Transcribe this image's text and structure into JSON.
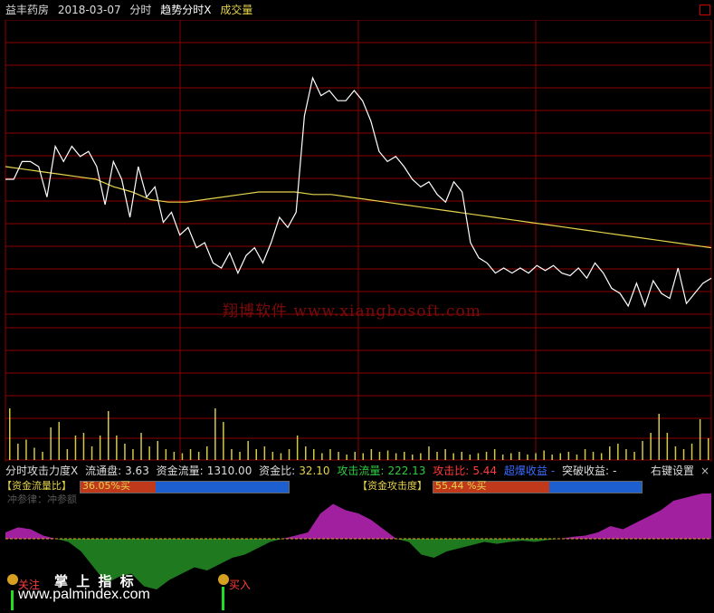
{
  "header": {
    "stock_name": "益丰药房",
    "date": "2018-03-07",
    "view": "分时",
    "indicator": "趋势分时X",
    "volume_label": "成交量"
  },
  "watermark": {
    "text": "翔博软件 www.xiangbosoft.com",
    "color": "#7a0b0b"
  },
  "indicator_bar": {
    "title": "分时攻击力度X",
    "float_label": "流通盘:",
    "float_value": "3.63",
    "fund_flow_label": "资金流量:",
    "fund_flow_value": "1310.00",
    "fund_ratio_label": "资金比:",
    "fund_ratio_value": "32.10",
    "attack_flow_label": "攻击流量:",
    "attack_flow_value": "222.13",
    "attack_ratio_label": "攻击比:",
    "attack_ratio_value": "5.44",
    "ultra_label": "超爆收益",
    "dash1": "-",
    "breakout_label": "突破收益:",
    "breakout_value": "-",
    "settings": "右键设置",
    "close": "×"
  },
  "fund_flow_ratio": {
    "label_open": "【资金流量比】",
    "value": "36.05%买",
    "fraction": 0.3605
  },
  "fund_attack": {
    "label_open": "【资金攻击度】",
    "value": "55.44 %买",
    "fraction": 0.5544
  },
  "sub_label": "冲参律：冲参额",
  "overlay": {
    "tag1": "关注",
    "slogan": "掌 上 指 标",
    "tag2": "买入",
    "url": "www.palmindex.com"
  },
  "colors": {
    "grid": "#8b0000",
    "price": "#ffffff",
    "avg": "#e5d34c",
    "volume": "#d4c84a",
    "pos": "#a020a0",
    "neg": "#1f7a1f",
    "red_bar": "#c0391b",
    "blue_bar": "#1e5fd0"
  },
  "chart_data": {
    "type": "line",
    "price_series": [
      0.55,
      0.55,
      0.62,
      0.62,
      0.6,
      0.48,
      0.68,
      0.62,
      0.68,
      0.64,
      0.66,
      0.6,
      0.45,
      0.62,
      0.55,
      0.4,
      0.6,
      0.48,
      0.52,
      0.38,
      0.42,
      0.33,
      0.36,
      0.28,
      0.3,
      0.22,
      0.2,
      0.26,
      0.18,
      0.25,
      0.28,
      0.22,
      0.3,
      0.4,
      0.36,
      0.42,
      0.8,
      0.95,
      0.88,
      0.9,
      0.86,
      0.86,
      0.9,
      0.86,
      0.78,
      0.66,
      0.62,
      0.64,
      0.6,
      0.55,
      0.52,
      0.54,
      0.49,
      0.46,
      0.54,
      0.5,
      0.3,
      0.24,
      0.22,
      0.18,
      0.2,
      0.18,
      0.2,
      0.18,
      0.21,
      0.19,
      0.21,
      0.18,
      0.17,
      0.2,
      0.16,
      0.22,
      0.18,
      0.12,
      0.1,
      0.05,
      0.14,
      0.05,
      0.15,
      0.1,
      0.08,
      0.2,
      0.06,
      0.1,
      0.14,
      0.16
    ],
    "avg_series": [
      0.6,
      0.59,
      0.58,
      0.57,
      0.56,
      0.55,
      0.52,
      0.5,
      0.47,
      0.46,
      0.46,
      0.47,
      0.48,
      0.49,
      0.5,
      0.5,
      0.5,
      0.49,
      0.49,
      0.48,
      0.47,
      0.46,
      0.45,
      0.44,
      0.43,
      0.42,
      0.41,
      0.4,
      0.39,
      0.38,
      0.37,
      0.36,
      0.35,
      0.34,
      0.33,
      0.32,
      0.31,
      0.3,
      0.29,
      0.28
    ],
    "volume": [
      0.38,
      0.12,
      0.15,
      0.09,
      0.06,
      0.24,
      0.28,
      0.08,
      0.18,
      0.2,
      0.1,
      0.18,
      0.36,
      0.18,
      0.12,
      0.08,
      0.2,
      0.1,
      0.14,
      0.08,
      0.06,
      0.05,
      0.08,
      0.06,
      0.1,
      0.38,
      0.28,
      0.08,
      0.06,
      0.14,
      0.08,
      0.1,
      0.06,
      0.05,
      0.08,
      0.18,
      0.1,
      0.08,
      0.05,
      0.08,
      0.06,
      0.04,
      0.06,
      0.05,
      0.08,
      0.06,
      0.07,
      0.05,
      0.06,
      0.04,
      0.05,
      0.1,
      0.06,
      0.08,
      0.05,
      0.06,
      0.04,
      0.05,
      0.06,
      0.08,
      0.04,
      0.05,
      0.06,
      0.04,
      0.05,
      0.07,
      0.04,
      0.05,
      0.06,
      0.04,
      0.08,
      0.06,
      0.05,
      0.1,
      0.12,
      0.08,
      0.06,
      0.14,
      0.2,
      0.34,
      0.2,
      0.1,
      0.08,
      0.12,
      0.3,
      0.16
    ],
    "attack": [
      0.1,
      0.18,
      0.15,
      0.05,
      0.0,
      -0.05,
      -0.2,
      -0.45,
      -0.7,
      -0.6,
      -0.55,
      -0.75,
      -0.8,
      -0.65,
      -0.55,
      -0.45,
      -0.5,
      -0.4,
      -0.3,
      -0.25,
      -0.15,
      -0.05,
      0.0,
      0.05,
      0.1,
      0.4,
      0.55,
      0.45,
      0.4,
      0.3,
      0.15,
      0.0,
      -0.05,
      -0.25,
      -0.3,
      -0.2,
      -0.15,
      -0.1,
      -0.05,
      -0.08,
      -0.05,
      -0.03,
      -0.05,
      -0.02,
      0.0,
      0.03,
      0.05,
      0.1,
      0.2,
      0.15,
      0.25,
      0.35,
      0.45,
      0.6,
      0.65,
      0.7,
      0.75
    ]
  }
}
